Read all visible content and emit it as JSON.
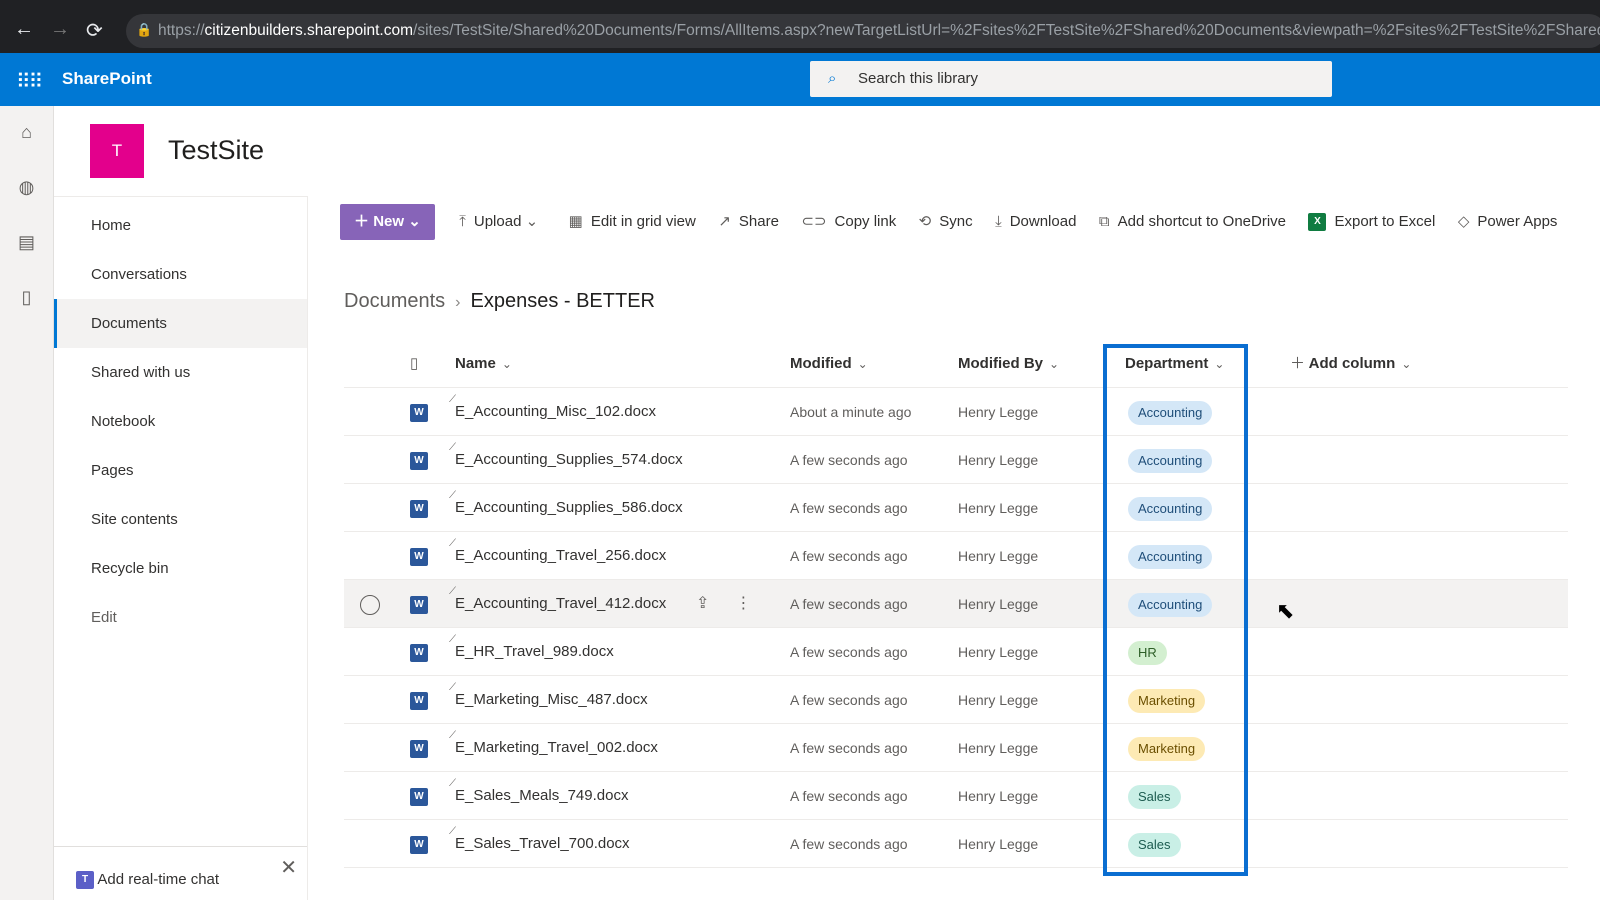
{
  "browser": {
    "url_prefix": "https://",
    "url_host": "citizenbuilders.sharepoint.com",
    "url_path": "/sites/TestSite/Shared%20Documents/Forms/AllItems.aspx?newTargetListUrl=%2Fsites%2FTestSite%2FShared%20Documents&viewpath=%2Fsites%2FTestSite%2FShared%2"
  },
  "suite": {
    "brand": "SharePoint",
    "search_placeholder": "Search this library"
  },
  "site": {
    "logo_letter": "T",
    "name": "TestSite"
  },
  "nav": {
    "items": [
      "Home",
      "Conversations",
      "Documents",
      "Shared with us",
      "Notebook",
      "Pages",
      "Site contents",
      "Recycle bin"
    ],
    "edit": "Edit",
    "selected": "Documents"
  },
  "chat": {
    "label": "Add real-time chat"
  },
  "commands": {
    "new": "New",
    "upload": "Upload",
    "edit_grid": "Edit in grid view",
    "share": "Share",
    "copy_link": "Copy link",
    "sync": "Sync",
    "download": "Download",
    "shortcut": "Add shortcut to OneDrive",
    "export": "Export to Excel",
    "power": "Power Apps"
  },
  "breadcrumb": {
    "parent": "Documents",
    "current": "Expenses - BETTER"
  },
  "table": {
    "headers": {
      "name": "Name",
      "modified": "Modified",
      "modified_by": "Modified By",
      "department": "Department",
      "add_column": "Add column"
    },
    "rows": [
      {
        "name": "E_Accounting_Misc_102.docx",
        "modified": "About a minute ago",
        "by": "Henry Legge",
        "dept": "Accounting"
      },
      {
        "name": "E_Accounting_Supplies_574.docx",
        "modified": "A few seconds ago",
        "by": "Henry Legge",
        "dept": "Accounting"
      },
      {
        "name": "E_Accounting_Supplies_586.docx",
        "modified": "A few seconds ago",
        "by": "Henry Legge",
        "dept": "Accounting"
      },
      {
        "name": "E_Accounting_Travel_256.docx",
        "modified": "A few seconds ago",
        "by": "Henry Legge",
        "dept": "Accounting"
      },
      {
        "name": "E_Accounting_Travel_412.docx",
        "modified": "A few seconds ago",
        "by": "Henry Legge",
        "dept": "Accounting"
      },
      {
        "name": "E_HR_Travel_989.docx",
        "modified": "A few seconds ago",
        "by": "Henry Legge",
        "dept": "HR"
      },
      {
        "name": "E_Marketing_Misc_487.docx",
        "modified": "A few seconds ago",
        "by": "Henry Legge",
        "dept": "Marketing"
      },
      {
        "name": "E_Marketing_Travel_002.docx",
        "modified": "A few seconds ago",
        "by": "Henry Legge",
        "dept": "Marketing"
      },
      {
        "name": "E_Sales_Meals_749.docx",
        "modified": "A few seconds ago",
        "by": "Henry Legge",
        "dept": "Sales"
      },
      {
        "name": "E_Sales_Travel_700.docx",
        "modified": "A few seconds ago",
        "by": "Henry Legge",
        "dept": "Sales"
      }
    ]
  },
  "dept_colors": {
    "Accounting": [
      "#d4e7f7",
      "#1f4e79"
    ],
    "HR": [
      "#d3efd0",
      "#2d5e27"
    ],
    "Marketing": [
      "#fdeab4",
      "#6b4f00"
    ],
    "Sales": [
      "#c9efe6",
      "#1d5c50"
    ]
  },
  "colors": {
    "suite": "#0078d4",
    "new_button": "#8764b8",
    "highlight": "#0a6ed1",
    "site_logo": "#e3008c"
  }
}
